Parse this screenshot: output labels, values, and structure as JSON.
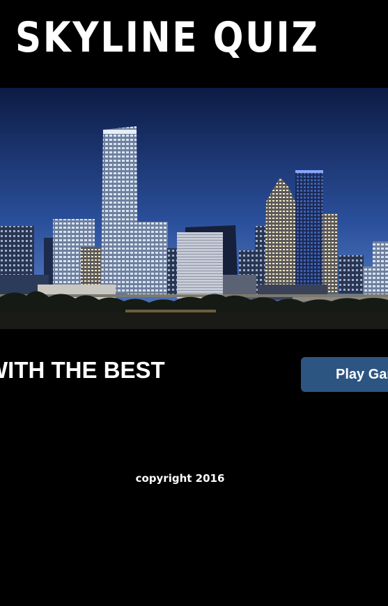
{
  "header": {
    "title": "SKYLINE QUIZ"
  },
  "hero": {
    "image_icon": "city-skyline-at-night",
    "colors": {
      "sky_top": "#0d1b45",
      "sky_bottom": "#4a6fb8",
      "buildings": "#1c2436",
      "lit_windows": "#d6e4f5"
    }
  },
  "main": {
    "tagline": "WITH THE BEST",
    "play_button_label": "Play Game"
  },
  "footer": {
    "copyright": "copyright 2016"
  },
  "colors": {
    "background": "#000000",
    "text": "#ffffff",
    "button": "#2d5582"
  }
}
